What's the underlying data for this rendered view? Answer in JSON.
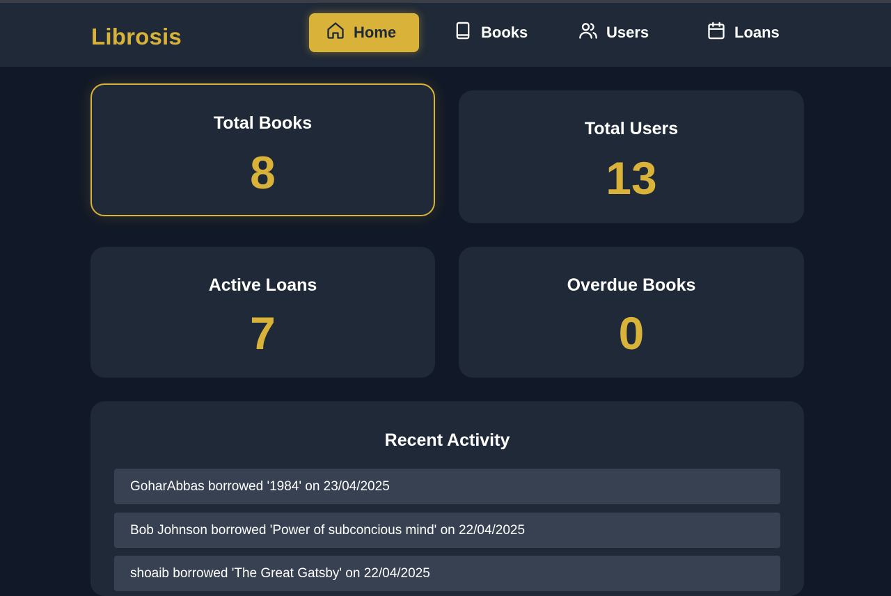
{
  "brand": "Librosis",
  "nav": {
    "home": "Home",
    "books": "Books",
    "users": "Users",
    "loans": "Loans",
    "active": "Home"
  },
  "stats": {
    "total_books_label": "Total Books",
    "total_books_value": "8",
    "total_users_label": "Total Users",
    "total_users_value": "13",
    "active_loans_label": "Active Loans",
    "active_loans_value": "7",
    "overdue_books_label": "Overdue Books",
    "overdue_books_value": "0"
  },
  "activity": {
    "title": "Recent Activity",
    "items": [
      "GoharAbbas borrowed '1984' on 23/04/2025",
      "Bob Johnson borrowed 'Power of subconcious mind' on 22/04/2025",
      "shoaib borrowed 'The Great Gatsby' on 22/04/2025"
    ]
  },
  "colors": {
    "accent": "#d9b23a",
    "background": "#111827",
    "card": "#1f2937",
    "row": "#374151"
  },
  "icons": {
    "home": "home-icon",
    "books": "book-icon",
    "users": "users-icon",
    "loans": "calendar-icon"
  }
}
